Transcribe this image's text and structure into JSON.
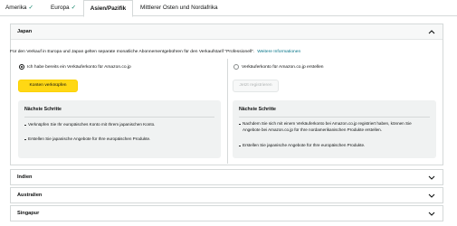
{
  "tabs": [
    {
      "label": "Amerika",
      "check": "✓"
    },
    {
      "label": "Europa",
      "check": "✓"
    },
    {
      "label": "Asien/Pazifik"
    },
    {
      "label": "Mittlerer Osten und Nordafrika"
    }
  ],
  "japan": {
    "title": "Japan",
    "intro": "Für den Verkauf in Europa und Japan gelten separate monatliche Abonnementgebühren für den Verkaufstarif \"Professionell\".",
    "more_info": "Weitere Informationen",
    "left": {
      "radio_label": "Ich habe bereits ein Verkäuferkonto für Amazon.co.jp",
      "selected": true,
      "button": "Konten verknüpfen",
      "steps_title": "Nächste Schritte",
      "steps": [
        "Verknüpfen Sie Ihr europäisches Konto mit Ihrem japanischen Konto.",
        "Erstellen Sie japanische Angebote für Ihre europäischen Produkte."
      ]
    },
    "right": {
      "radio_label": "Verkäuferkonto für Amazon.co.jp erstellen",
      "selected": false,
      "button": "Jetzt registrieren",
      "steps_title": "Nächste Schritte",
      "steps": [
        "Nachdem Sie sich mit einem Verkäuferkonto bei Amazon.co.jp registriert haben, können Sie Angebote bei Amazon.co.jp für Ihre nordamerikanischen Produkte erstellen.",
        "Erstellen Sie japanische Angebote für Ihre europäischen Produkte."
      ]
    }
  },
  "sections": [
    {
      "title": "Indien"
    },
    {
      "title": "Australien"
    },
    {
      "title": "Singapur"
    }
  ],
  "colors": {
    "primary_button": "#ffd814",
    "link": "#007185",
    "check": "#067d62",
    "steps_bg": "#f0f2f2"
  }
}
